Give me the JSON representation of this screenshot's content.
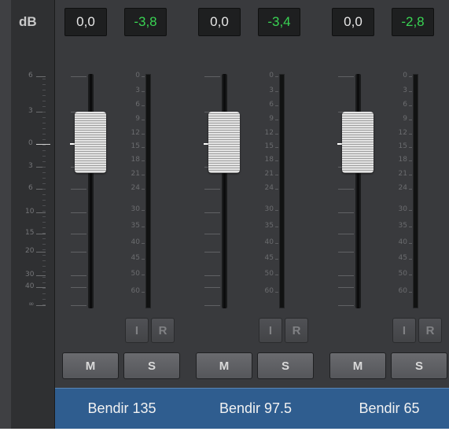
{
  "scale": {
    "label": "dB",
    "left_marks": [
      "6",
      "3",
      "0",
      "3",
      "6",
      "10",
      "15",
      "20",
      "30",
      "40",
      "∞"
    ]
  },
  "meter_scale": [
    "0",
    "3",
    "6",
    "9",
    "12",
    "15",
    "18",
    "21",
    "24",
    "30",
    "35",
    "40",
    "45",
    "50",
    "60"
  ],
  "channels": [
    {
      "name": "Bendir 135",
      "volume": "0,0",
      "peak": "-3,8",
      "input_label": "I",
      "record_label": "R",
      "mute_label": "M",
      "solo_label": "S"
    },
    {
      "name": "Bendir 97.5",
      "volume": "0,0",
      "peak": "-3,4",
      "input_label": "I",
      "record_label": "R",
      "mute_label": "M",
      "solo_label": "S"
    },
    {
      "name": "Bendir 65",
      "volume": "0,0",
      "peak": "-2,8",
      "input_label": "I",
      "record_label": "R",
      "mute_label": "M",
      "solo_label": "S"
    }
  ],
  "colors": {
    "peak": "#39d353",
    "name_bar": "#2f5d8f",
    "panel": "#3f4043"
  }
}
